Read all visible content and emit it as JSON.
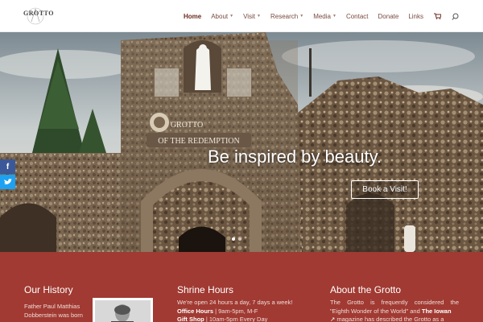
{
  "header": {
    "logo_text": "GROTTO",
    "nav": [
      {
        "label": "Home",
        "active": true,
        "has_dropdown": false
      },
      {
        "label": "About",
        "active": false,
        "has_dropdown": true
      },
      {
        "label": "Visit",
        "active": false,
        "has_dropdown": true
      },
      {
        "label": "Research",
        "active": false,
        "has_dropdown": true
      },
      {
        "label": "Media",
        "active": false,
        "has_dropdown": true
      },
      {
        "label": "Contact",
        "active": false,
        "has_dropdown": false
      },
      {
        "label": "Donate",
        "active": false,
        "has_dropdown": false
      },
      {
        "label": "Links",
        "active": false,
        "has_dropdown": false
      }
    ],
    "icons": [
      "cart-icon",
      "search-icon"
    ]
  },
  "hero": {
    "headline": "Be inspired by beauty.",
    "button_label": "Book a Visit!",
    "sign_line1": "GROTTO",
    "sign_line2": "OF THE REDEMPTION",
    "slide_count": 2,
    "active_slide": 0
  },
  "share": {
    "facebook": "f",
    "twitter": "t"
  },
  "columns": {
    "history": {
      "title": "Our History",
      "text_line1": "Father Paul Matthias",
      "text_line2": "Dobberstein was born"
    },
    "hours": {
      "title": "Shrine Hours",
      "line1": "We're open 24 hours a day, 7 days a week!",
      "office_label": "Office Hours",
      "office_value": " | 9am-5pm, M-F",
      "gift_label": "Gift Shop",
      "gift_value": " | 10am-5pm Every Day"
    },
    "about": {
      "title": "About the Grotto",
      "line1": "The Grotto is frequently considered the",
      "line2_pre": "\"Eighth Wonder of the World\" and ",
      "line2_bold": "The Iowan",
      "line3": " magazine has described the Grotto as a"
    }
  },
  "colors": {
    "accent": "#a03a32",
    "nav_text": "#7a4b3f",
    "band_text": "#f1dcd8"
  }
}
